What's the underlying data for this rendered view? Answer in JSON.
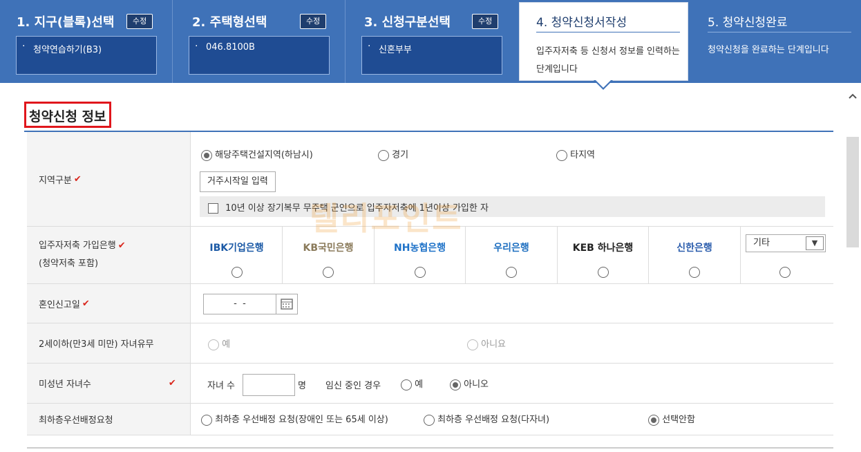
{
  "steps": [
    {
      "title": "1. 지구(블록)선택",
      "edit": "수정",
      "value": "청약연습하기(B3)"
    },
    {
      "title": "2. 주택형선택",
      "edit": "수정",
      "value": "046.8100B"
    },
    {
      "title": "3. 신청구분선택",
      "edit": "수정",
      "value": "신혼부부"
    }
  ],
  "active_step": {
    "title": "4. 청약신청서작성",
    "desc": "입주자저축 등 신청서 정보를 인력하는 단계입니다"
  },
  "done_step": {
    "title": "5. 청약신청완료",
    "desc": "청약신청을 완료하는 단계입니다"
  },
  "section_title": "청약신청 정보",
  "watermark": "텔리포인트",
  "region": {
    "label": "지역구분",
    "options": [
      "해당주택건설지역(하남시)",
      "경기",
      "타지역"
    ],
    "selected": 0,
    "button": "거주시작일 입력",
    "checkbox": "10년 이상 장기복무 무주택 군인으로 입주자저축에 1년이상 가입한 자"
  },
  "bank": {
    "label": "입주자저축 가입은행",
    "label2": "(청약저축 포함)",
    "banks": [
      "IBK기업은행",
      "KB국민은행",
      "NH농협은행",
      "우리은행",
      "KEB 하나은행",
      "신한은행"
    ],
    "other_select": "기타",
    "colors": {
      "ibk": "#1c5aa6",
      "kb": "#8a7a5a",
      "nh": "#1e72c8",
      "woori": "#1e6fc0",
      "keb": "#222222",
      "shinhan": "#2a5cac"
    }
  },
  "marriage": {
    "label": "혼인신고일",
    "value": " -  - "
  },
  "infant": {
    "label": "2세이하(만3세 미만) 자녀유무",
    "options": [
      "예",
      "아니요"
    ]
  },
  "children": {
    "label": "미성년 자녀수",
    "count_label": "자녀 수",
    "unit": "명",
    "pregnancy_label": "임신 중인 경우",
    "options": [
      "예",
      "아니오"
    ],
    "selected": 1
  },
  "floor": {
    "label": "최하층우선배정요청",
    "options": [
      "최하층 우선배정 요청(장애인 또는 65세 이상)",
      "최하층 우선배정 요청(다자녀)",
      "선택안함"
    ],
    "selected": 2
  }
}
